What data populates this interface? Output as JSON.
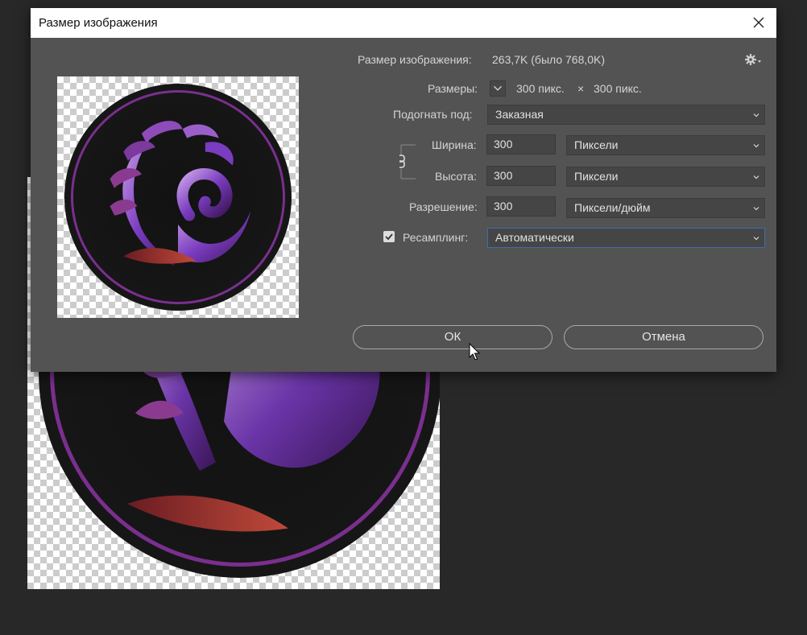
{
  "dialog": {
    "title": "Размер изображения",
    "size_label": "Размер изображения:",
    "size_value": "263,7K (было 768,0K)",
    "dims_label": "Размеры:",
    "dims_width": "300 пикс.",
    "dims_sep": "×",
    "dims_height": "300 пикс.",
    "fit_label": "Подогнать под:",
    "fit_value": "Заказная",
    "width_label": "Ширина:",
    "width_value": "300",
    "width_unit": "Пиксели",
    "height_label": "Высота:",
    "height_value": "300",
    "height_unit": "Пиксели",
    "resolution_label": "Разрешение:",
    "resolution_value": "300",
    "resolution_unit": "Пиксели/дюйм",
    "resample_label": "Ресамплинг:",
    "resample_checked": true,
    "resample_value": "Автоматически",
    "ok_label": "ОК",
    "cancel_label": "Отмена"
  },
  "colors": {
    "dialog_bg": "#535353",
    "canvas_bg": "#282828",
    "ring": "#7a2f8f",
    "focus_border": "#3d6db0"
  },
  "icons": [
    "close-icon",
    "gear-icon",
    "chevron-down-icon",
    "link-icon",
    "checkbox-checked-icon",
    "mouse-cursor-icon"
  ]
}
